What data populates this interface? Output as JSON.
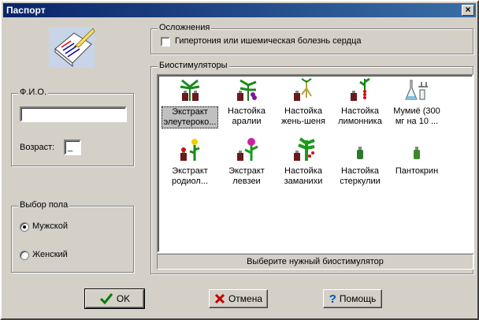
{
  "window": {
    "title": "Паспорт",
    "close_label": "×"
  },
  "complications": {
    "legend": "Осложнения",
    "checkbox_label": "Гипертония или ишемическая болезнь сердца",
    "checked": false
  },
  "fio": {
    "legend": "Ф.И.О.",
    "value": "",
    "age_label": "Возраст:",
    "age_value": "_"
  },
  "gender": {
    "legend": "Выбор пола",
    "options": [
      {
        "label": "Мужской",
        "selected": true
      },
      {
        "label": "Женский",
        "selected": false
      }
    ]
  },
  "biostim": {
    "legend": "Биостимуляторы",
    "items": [
      {
        "line1": "Экстракт",
        "line2": "элеутероко...",
        "selected": true,
        "icon": "eleutherococcus-icon"
      },
      {
        "line1": "Настойка",
        "line2": "аралии",
        "selected": false,
        "icon": "aralia-icon"
      },
      {
        "line1": "Настойка",
        "line2": "жень-шеня",
        "selected": false,
        "icon": "ginseng-icon"
      },
      {
        "line1": "Настойка",
        "line2": "лимонника",
        "selected": false,
        "icon": "schisandra-icon"
      },
      {
        "line1": "Мумиё (300",
        "line2": "мг на 10 ...",
        "selected": false,
        "icon": "mumie-icon"
      },
      {
        "line1": "Экстракт",
        "line2": "родиол...",
        "selected": false,
        "icon": "rhodiola-icon"
      },
      {
        "line1": "Экстракт",
        "line2": "левзеи",
        "selected": false,
        "icon": "leuzea-icon"
      },
      {
        "line1": "Настойка",
        "line2": "заманихи",
        "selected": false,
        "icon": "zamanikha-icon"
      },
      {
        "line1": "Настойка",
        "line2": "стеркулии",
        "selected": false,
        "icon": "sterculia-icon"
      },
      {
        "line1": "Пантокрин",
        "line2": "",
        "selected": false,
        "icon": "pantocrine-icon"
      }
    ],
    "status": "Выберите нужный биостимулятор"
  },
  "buttons": {
    "ok": "OK",
    "cancel": "Отмена",
    "help": "Помощь"
  }
}
